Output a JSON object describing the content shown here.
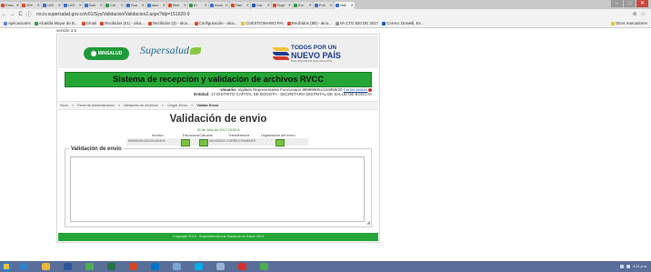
{
  "browser": {
    "tabs": [
      {
        "label": "Exec",
        "color": "#d94a2b"
      },
      {
        "label": "20!!",
        "color": "#d94a2b"
      },
      {
        "label": "UGI",
        "color": "#3a6fcf"
      },
      {
        "label": "UGI",
        "color": "#3a6fcf"
      },
      {
        "label": "Don",
        "color": "#3a6fcf"
      },
      {
        "label": "Cor",
        "color": "#2d9b4a"
      },
      {
        "label": "Sun",
        "color": "#3a6fcf"
      },
      {
        "label": "secr",
        "color": "#2d7dd2"
      },
      {
        "label": "Sen",
        "color": "#d94a2b"
      },
      {
        "label": "Kr",
        "color": "#2d9b4a"
      },
      {
        "label": "noon",
        "color": "#3a6fcf"
      },
      {
        "label": "Dan",
        "color": "#d94a2b"
      },
      {
        "label": "Cor",
        "color": "#1f57b5"
      },
      {
        "label": "Supr",
        "color": "#d94a2b"
      },
      {
        "label": "Ecr",
        "color": "#2d9b4a"
      },
      {
        "label": "Fon",
        "color": "#3a6fcf"
      },
      {
        "label": "Vali",
        "color": "#3a6fcf",
        "active": true
      }
    ],
    "window_buttons": {
      "minimize": "–",
      "maximize": "□",
      "close": "✕"
    },
    "nav": {
      "back": "←",
      "forward": "→",
      "reload": "C",
      "info": "ⓘ"
    },
    "url": "rvccv.supersalud.gov.co/v01/Sys/Validacion/Validacion2.aspx?idp=151620-9",
    "addr_icons": {
      "zoom": "⊕",
      "star": "☆"
    },
    "bookmarks": [
      {
        "label": "Aplicaciones",
        "color": "#5a86d6"
      },
      {
        "label": "Alcaldía Mayor de B...",
        "color": "#2d9b4a"
      },
      {
        "label": "Gmail",
        "color": "#d94a2b"
      },
      {
        "label": "Recibidos (41) - alca...",
        "color": "#d94a2b"
      },
      {
        "label": "Recibidos (3) - alca...",
        "color": "#d94a2b"
      },
      {
        "label": "Configuración - alca...",
        "color": "#d94a2b"
      },
      {
        "label": "CUESTIONARIO PAI",
        "color": "#e8c22c"
      },
      {
        "label": "Recibidos (89) - alca...",
        "color": "#d94a2b"
      },
      {
        "label": "VA CTO 820 DE 2017",
        "color": "#999999"
      },
      {
        "label": "Correo: Donwill, Ev...",
        "color": "#1f57b5"
      },
      {
        "label": "Otros marcadores",
        "color": "#e8c22c"
      }
    ]
  },
  "page": {
    "version": "versión 3.5",
    "logos": {
      "minsalud": "MINSALUD",
      "supersalud": "Supersalud",
      "todos_line1": "TODOS POR UN",
      "todos_line2": "NUEVO PAÍS",
      "todos_line3": "PAZ EQUIDAD EDUCACIÓN"
    },
    "title": "Sistema de recepción y validación de archivos RVCC",
    "user": {
      "label": "Usuario:",
      "value": "Vigilado Representante Funcionario 899999061/184950/20",
      "logout": "Cerrar sesión",
      "entity_label": "Entidad:",
      "entity_code": "17",
      "entity_name": "DISTRITO CAPITAL DE BOGOTA - SECRETARIA DISTRITAL DE SALUD DE BOGOTA"
    },
    "breadcrumb": [
      "Inicio",
      "Panel de Administración",
      "Validación de Archivos",
      "Cargar Envío",
      "Validar Envío"
    ],
    "validation": {
      "heading": "Validación de envio",
      "date": "30 de Julio de 2017 15:53:8",
      "columns": [
        "Archivo",
        "Estructura/Cálculos",
        "Transferencia",
        "Legalización del envío"
      ],
      "file_name": "899999061001201604H4",
      "transfer_text": "VALIDADO CORRECTAMENTE"
    },
    "panel": {
      "legend": "Validación de envio",
      "textarea_value": ""
    },
    "footer": "Copyright 2015 - Superintendencia Nacional de Salud 2015"
  },
  "taskbar": {
    "apps": [
      {
        "name": "ie-icon",
        "color": "#2d82c8"
      },
      {
        "name": "folder-icon",
        "color": "#e8b83a"
      },
      {
        "name": "word-icon",
        "color": "#2b579a"
      },
      {
        "name": "chrome-icon",
        "color": "#4caf50"
      },
      {
        "name": "excel-icon",
        "color": "#217346"
      },
      {
        "name": "powerpoint-icon",
        "color": "#d24726"
      },
      {
        "name": "outlook-icon",
        "color": "#0072c6"
      },
      {
        "name": "paint-icon",
        "color": "#7aa6d6"
      },
      {
        "name": "skype-icon",
        "color": "#00aff0"
      },
      {
        "name": "notepad-icon",
        "color": "#9ab3d4"
      },
      {
        "name": "acrobat-icon",
        "color": "#d4302a"
      },
      {
        "name": "chrome-icon",
        "color": "#4caf50"
      }
    ],
    "time": "4:21 p.m."
  }
}
